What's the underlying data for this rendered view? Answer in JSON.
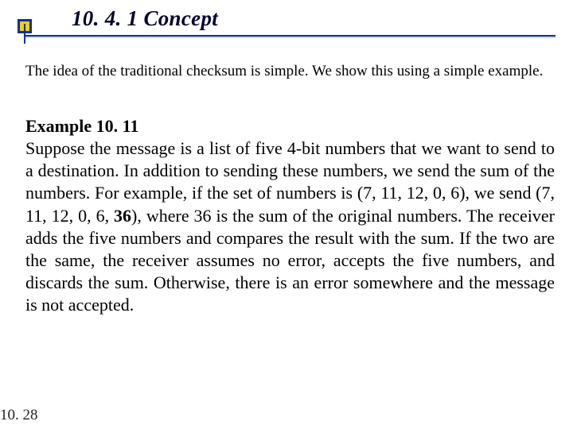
{
  "heading": "10. 4. 1 Concept",
  "intro": "The idea of the traditional checksum is simple. We show this using a simple example.",
  "example": {
    "title": "Example 10. 11",
    "body_before36": "Suppose the message is a list of five 4-bit numbers that we want to send to a destination. In addition to sending these numbers, we send the sum of the numbers. For example, if the set of numbers is (7, 11, 12, 0, 6), we send (7, 11, 12, 0, 6, ",
    "bold36": "36",
    "body_after36": "), where 36 is the sum of the original numbers. The receiver adds the five numbers and compares the result with the sum. If the two are the same, the receiver assumes no error, accepts the five numbers, and discards the sum. Otherwise, there is an error somewhere and the message is not accepted."
  },
  "footer": "10. 28"
}
